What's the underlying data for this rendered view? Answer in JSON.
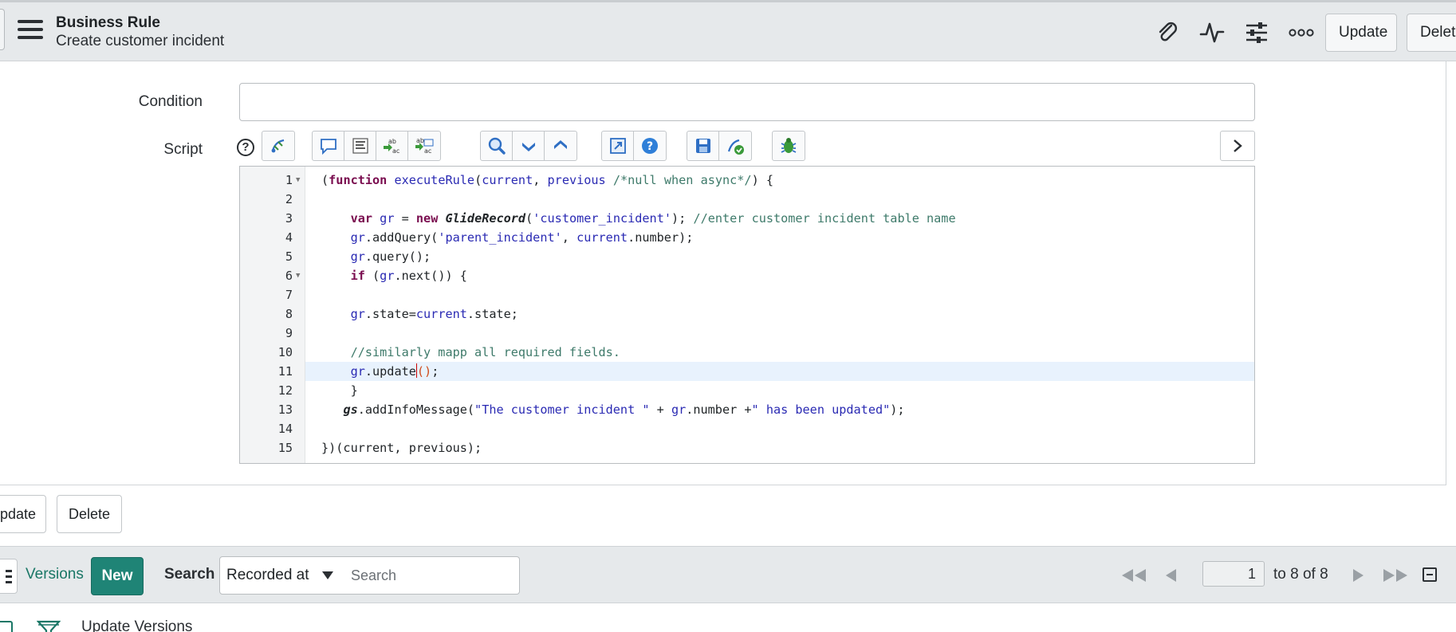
{
  "header": {
    "title": "Business Rule",
    "subtitle": "Create customer incident",
    "icons": [
      "paperclip-icon",
      "activity-icon",
      "sliders-icon",
      "more-icon"
    ],
    "update_label": "Update",
    "delete_label": "Delete"
  },
  "form": {
    "condition_label": "Condition",
    "condition_value": "",
    "script_label": "Script",
    "help_glyph": "?"
  },
  "toolbar": {
    "buttons": [
      "toggle-syntax-icon",
      "comment-icon",
      "format-icon",
      "replace-icon",
      "replace-all-icon",
      "search-icon",
      "next-icon",
      "previous-icon",
      "fullscreen-icon",
      "help-icon",
      "save-icon",
      "script-check-icon",
      "debug-icon"
    ]
  },
  "editor": {
    "line_numbers": [
      "1",
      "2",
      "3",
      "4",
      "5",
      "6",
      "7",
      "8",
      "9",
      "10",
      "11",
      "12",
      "13",
      "14",
      "15"
    ]
  },
  "footer": {
    "update_label": "Update",
    "delete_label": "Delete"
  },
  "related_list": {
    "tab_label": "Versions",
    "new_label": "New",
    "search_label": "Search",
    "search_field_selected": "Recorded at",
    "search_placeholder": "Search",
    "current_page": "1",
    "range_text": "to 8 of 8",
    "sub_text": "Update Versions"
  },
  "colors": {
    "accent": "#1f8476",
    "header_bg": "#e6e9eb",
    "keyword": "#7a0d4f",
    "string": "#2a2ab3",
    "comment": "#3e7a6a"
  }
}
